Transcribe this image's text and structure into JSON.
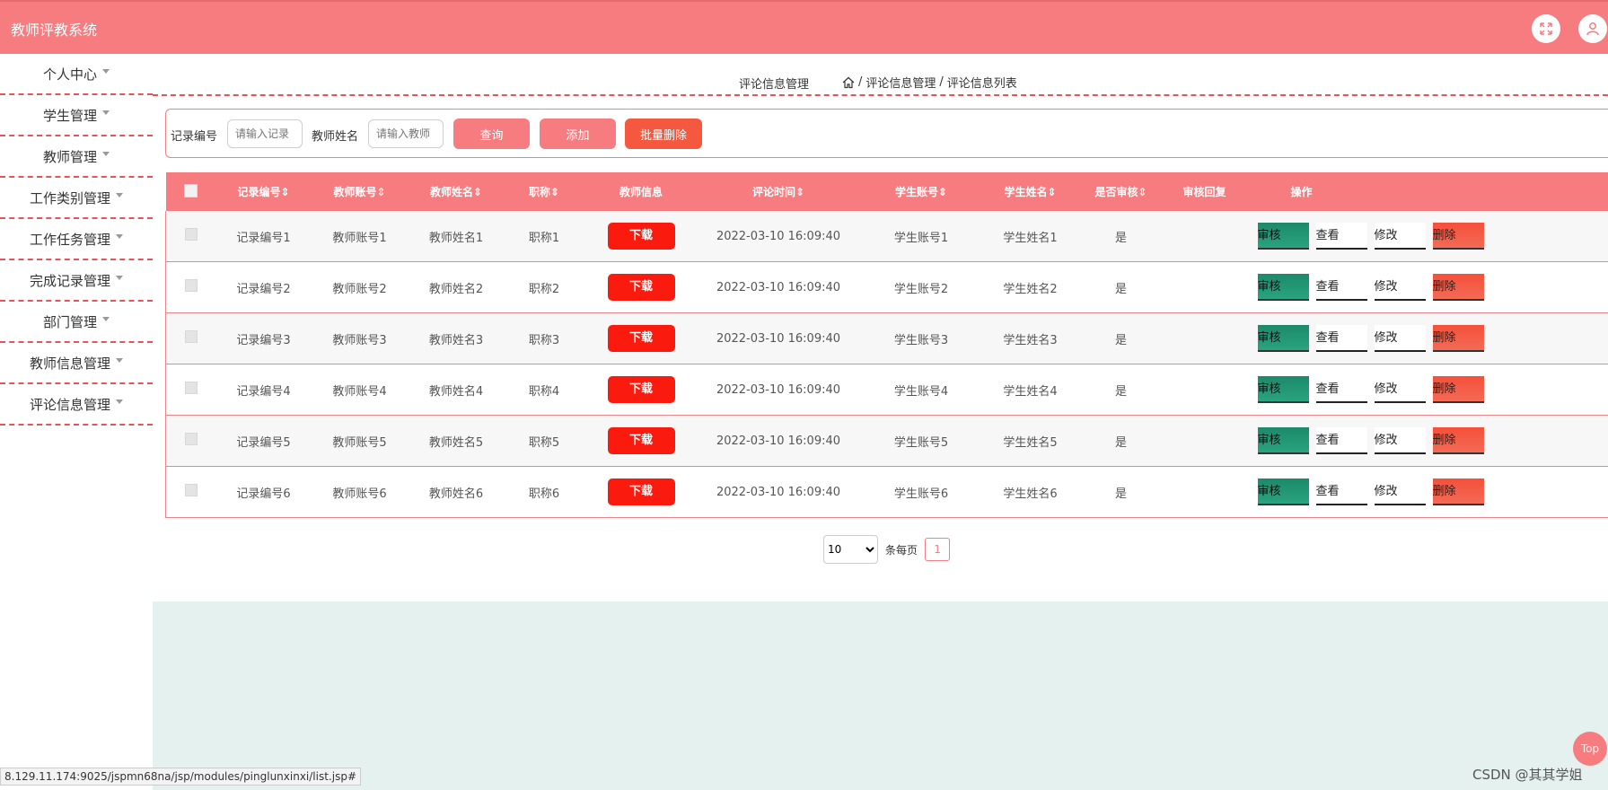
{
  "app": {
    "title": "教师评教系统"
  },
  "sidebar": {
    "items": [
      {
        "label": "个人中心"
      },
      {
        "label": "学生管理"
      },
      {
        "label": "教师管理"
      },
      {
        "label": "工作类别管理"
      },
      {
        "label": "工作任务管理"
      },
      {
        "label": "完成记录管理"
      },
      {
        "label": "部门管理"
      },
      {
        "label": "教师信息管理"
      },
      {
        "label": "评论信息管理"
      }
    ]
  },
  "breadcrumb": {
    "title": "评论信息管理",
    "path1": "评论信息管理",
    "sep": "/",
    "path2": "评论信息列表"
  },
  "search": {
    "label_record": "记录编号",
    "placeholder_record": "请输入记录",
    "label_teacher": "教师姓名",
    "placeholder_teacher": "请输入教师",
    "btn_query": "查询",
    "btn_add": "添加",
    "btn_batch_delete": "批量删除",
    "colors": {
      "query": "#f67c7f",
      "add": "#f67c7f",
      "batch_delete": "#f4583e"
    }
  },
  "table": {
    "headers": [
      "记录编号",
      "教师账号",
      "教师姓名",
      "职称",
      "教师信息",
      "评论时间",
      "学生账号",
      "学生姓名",
      "是否审核",
      "审核回复",
      "操作"
    ],
    "rows": [
      {
        "record": "记录编号1",
        "account": "教师账号1",
        "name": "教师姓名1",
        "title": "职称1",
        "info": "下载",
        "time": "2022-03-10 16:09:40",
        "stu_acc": "学生账号1",
        "stu_name": "学生姓名1",
        "audited": "是",
        "reply": ""
      },
      {
        "record": "记录编号2",
        "account": "教师账号2",
        "name": "教师姓名2",
        "title": "职称2",
        "info": "下载",
        "time": "2022-03-10 16:09:40",
        "stu_acc": "学生账号2",
        "stu_name": "学生姓名2",
        "audited": "是",
        "reply": ""
      },
      {
        "record": "记录编号3",
        "account": "教师账号3",
        "name": "教师姓名3",
        "title": "职称3",
        "info": "下载",
        "time": "2022-03-10 16:09:40",
        "stu_acc": "学生账号3",
        "stu_name": "学生姓名3",
        "audited": "是",
        "reply": ""
      },
      {
        "record": "记录编号4",
        "account": "教师账号4",
        "name": "教师姓名4",
        "title": "职称4",
        "info": "下载",
        "time": "2022-03-10 16:09:40",
        "stu_acc": "学生账号4",
        "stu_name": "学生姓名4",
        "audited": "是",
        "reply": ""
      },
      {
        "record": "记录编号5",
        "account": "教师账号5",
        "name": "教师姓名5",
        "title": "职称5",
        "info": "下载",
        "time": "2022-03-10 16:09:40",
        "stu_acc": "学生账号5",
        "stu_name": "学生姓名5",
        "audited": "是",
        "reply": ""
      },
      {
        "record": "记录编号6",
        "account": "教师账号6",
        "name": "教师姓名6",
        "title": "职称6",
        "info": "下载",
        "time": "2022-03-10 16:09:40",
        "stu_acc": "学生账号6",
        "stu_name": "学生姓名6",
        "audited": "是",
        "reply": ""
      }
    ],
    "actions": {
      "audit": "审核",
      "view": "查看",
      "edit": "修改",
      "delete": "删除"
    }
  },
  "pager": {
    "page_size": "10",
    "page_size_options": [
      "10"
    ],
    "per_page_label": "条每页",
    "current_page": "1"
  },
  "status_bar": {
    "url": "8.129.11.174:9025/jspmn68na/jsp/modules/pinglunxinxi/list.jsp#"
  },
  "top_button": "Top",
  "watermark": "CSDN @其其学姐",
  "icons": {
    "fullscreen": "expand-icon",
    "user": "user-icon",
    "home": "home-icon",
    "sort": "sort-icon",
    "caret": "chevron-down-icon"
  },
  "theme": {
    "accent": "#f67c7f",
    "danger": "#fb1a0e",
    "success": "#1b8a6a"
  }
}
